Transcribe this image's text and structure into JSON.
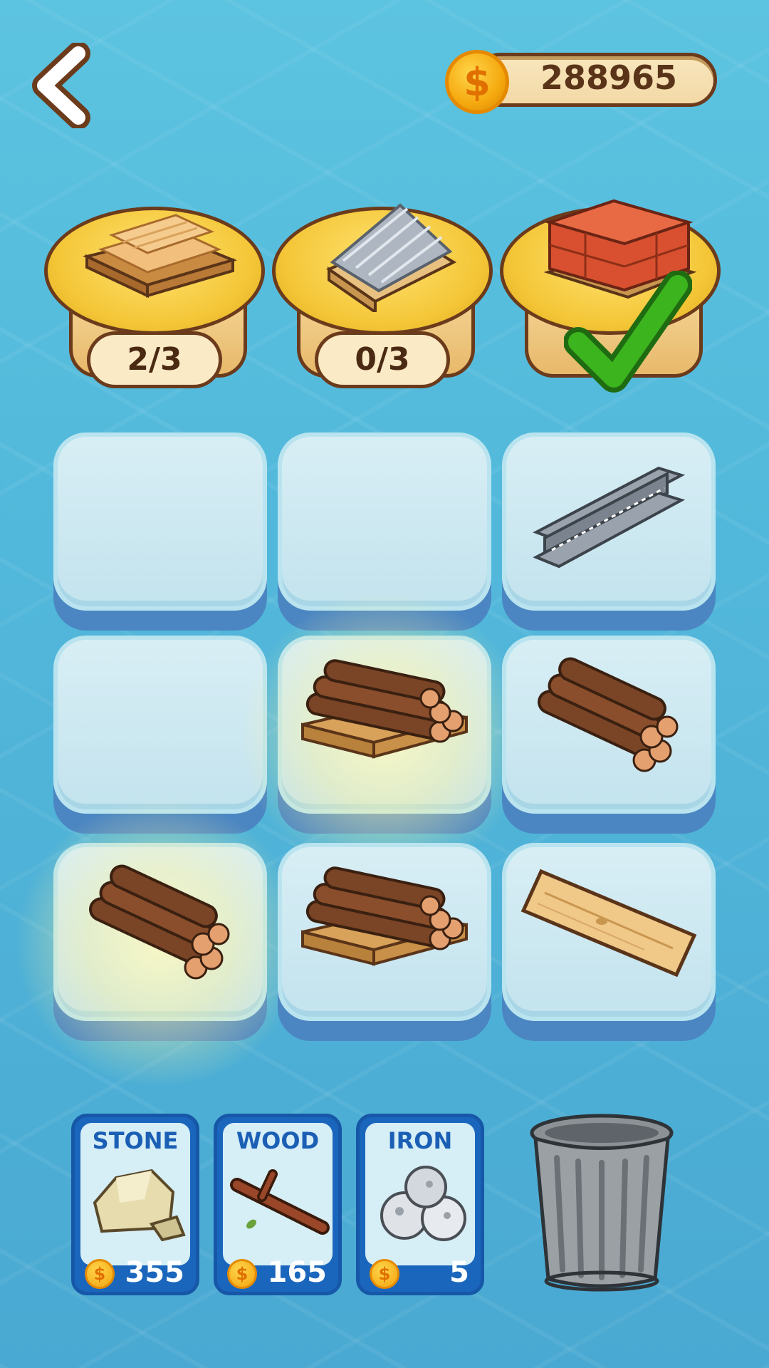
{
  "header": {
    "coins": "288965",
    "coin_symbol": "$"
  },
  "goals": [
    {
      "item": "wood-planks-pallet-icon",
      "progress": "2/3",
      "complete": false
    },
    {
      "item": "metal-sheets-pallet-icon",
      "progress": "0/3",
      "complete": false
    },
    {
      "item": "bricks-pallet-icon",
      "progress": "",
      "complete": true
    }
  ],
  "grid": [
    {
      "item": null
    },
    {
      "item": null
    },
    {
      "item": "steel-beam-icon"
    },
    {
      "item": null
    },
    {
      "item": "log-pallet-icon",
      "glow": true
    },
    {
      "item": "log-bundle-icon"
    },
    {
      "item": "log-bundle-icon",
      "glow": true
    },
    {
      "item": "log-pallet-icon"
    },
    {
      "item": "wood-plank-icon"
    }
  ],
  "shop": [
    {
      "label": "STONE",
      "price": "355",
      "icon": "stone-icon"
    },
    {
      "label": "WOOD",
      "price": "165",
      "icon": "branch-icon"
    },
    {
      "label": "IRON",
      "price": "5",
      "icon": "iron-ore-icon"
    }
  ],
  "shop_coin_symbol": "$",
  "colors": {
    "background": "#52b8db",
    "gold": "#f4c637",
    "outline": "#6b3b1c",
    "card_blue": "#1b66bd",
    "check_green": "#3cb41e"
  }
}
